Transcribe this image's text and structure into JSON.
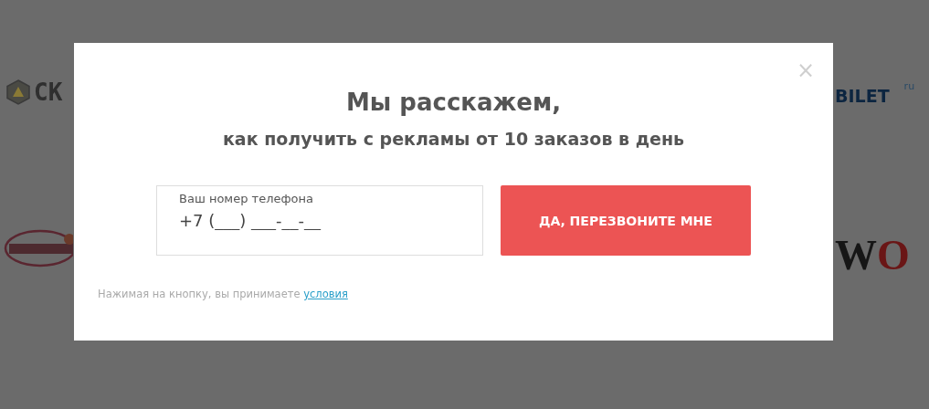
{
  "background_logos": [
    {
      "kind": "hex",
      "text": "СК"
    },
    {
      "kind": "ellipse"
    },
    {
      "kind": "bilet",
      "text": "BILET",
      "suffix": "ru"
    },
    {
      "kind": "serif",
      "text": "W",
      "accent": "O"
    }
  ],
  "modal": {
    "close": "×",
    "title": "Мы расскажем,",
    "subtitle": "как получить с рекламы от 10 заказов в день",
    "phone_field": {
      "label": "Ваш номер телефона",
      "value": "+7 (___) ___-__-__"
    },
    "button": "ДА, ПЕРЕЗВОНИТЕ МНЕ",
    "note": "Нажимая на кнопку, вы принимаете",
    "note_link": "условия"
  }
}
